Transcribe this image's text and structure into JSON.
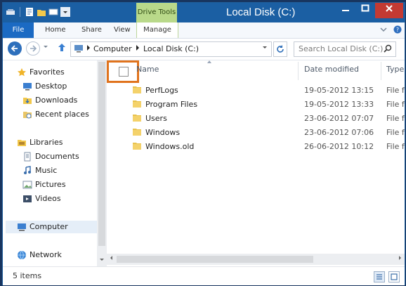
{
  "window": {
    "title": "Local Disk (C:)",
    "context_tab": "Drive Tools"
  },
  "ribbon": {
    "tabs": [
      "File",
      "Home",
      "Share",
      "View",
      "Manage"
    ]
  },
  "address": {
    "crumbs": [
      "Computer",
      "Local Disk (C:)"
    ],
    "search_placeholder": "Search Local Disk (C:)"
  },
  "nav": {
    "favorites": "Favorites",
    "desktop": "Desktop",
    "downloads": "Downloads",
    "recent": "Recent places",
    "libraries": "Libraries",
    "documents": "Documents",
    "music": "Music",
    "pictures": "Pictures",
    "videos": "Videos",
    "computer": "Computer",
    "network": "Network"
  },
  "columns": {
    "name": "Name",
    "date": "Date modified",
    "type": "Type"
  },
  "files": [
    {
      "name": "PerfLogs",
      "date": "19-05-2012 13:15",
      "type": "File f"
    },
    {
      "name": "Program Files",
      "date": "19-05-2012 13:33",
      "type": "File f"
    },
    {
      "name": "Users",
      "date": "23-06-2012 07:07",
      "type": "File f"
    },
    {
      "name": "Windows",
      "date": "23-06-2012 07:06",
      "type": "File f"
    },
    {
      "name": "Windows.old",
      "date": "26-06-2012 10:12",
      "type": "File f"
    }
  ],
  "status": {
    "items": "5 items"
  },
  "colors": {
    "title_bar": "#1b5fa3",
    "file_tab": "#1b6ac3",
    "context_tab": "#b9d98a",
    "highlight": "#e0731d",
    "folder": "#e8c24d"
  }
}
